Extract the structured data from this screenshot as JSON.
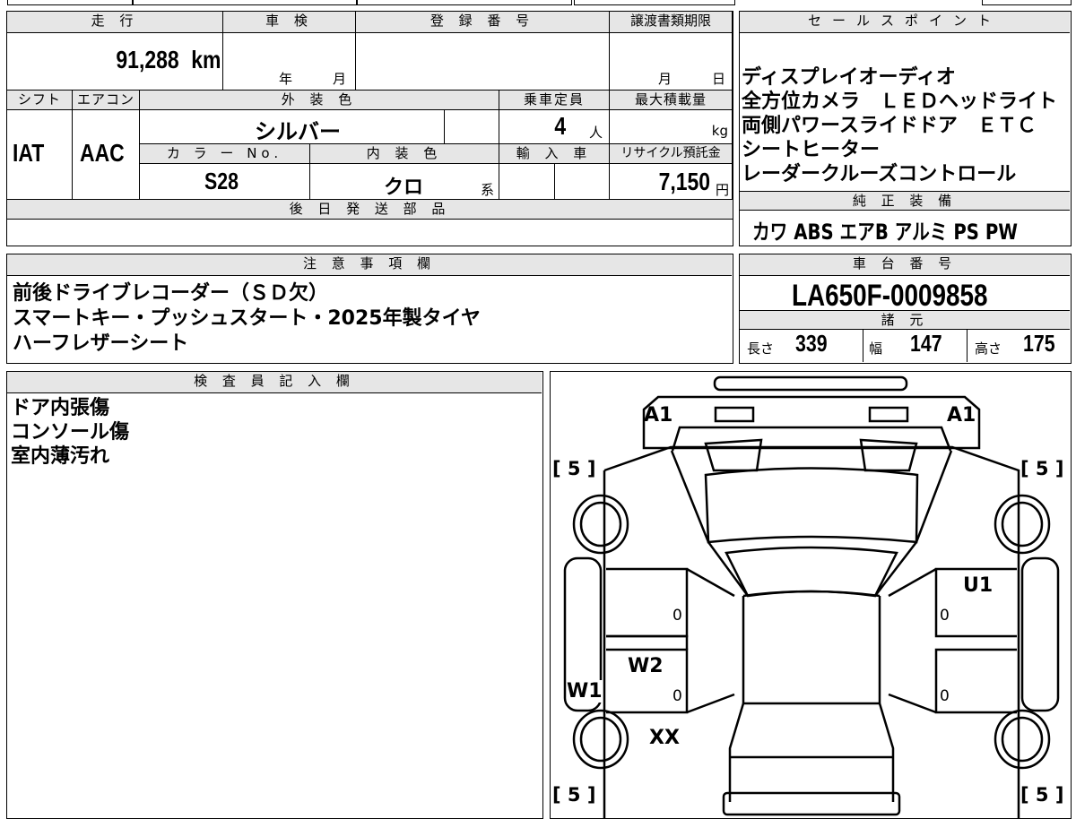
{
  "vehicle": {
    "mileage_label": "走 行",
    "mileage_value": "91,288",
    "mileage_unit": "km",
    "shaken_label": "車 検",
    "shaken_year": "年",
    "shaken_month": "月",
    "reg_label": "登 録 番 号",
    "transfer_label": "譲渡書類期限",
    "transfer_month": "月",
    "transfer_day": "日",
    "shift_label": "シフト",
    "shift_value": "IAT",
    "ac_label": "エアコン",
    "ac_value": "AAC",
    "exterior_label": "外 装 色",
    "exterior_value": "シルバー",
    "capacity_label": "乗車定員",
    "capacity_value": "4",
    "capacity_unit": "人",
    "load_label": "最大積載量",
    "load_unit": "kg",
    "colorno_label": "カ ラ ー No.",
    "colorno_value": "S28",
    "interior_label": "内 装 色",
    "interior_value": "クロ",
    "interior_suffix": "系",
    "import_label": "輸 入 車",
    "recycle_label": "リサイクル預託金",
    "recycle_value": "7,150",
    "recycle_unit": "円",
    "later_label": "後 日 発 送 部 品"
  },
  "sales": {
    "label": "セールスポイント",
    "lines": [
      "ディスプレイオーディオ",
      "全方位カメラ　ＬＥＤヘッドライト",
      "両側パワースライドドア　ＥＴＣ",
      "シートヒーター",
      "レーダークルーズコントロール"
    ]
  },
  "equipment": {
    "label": "純 正 装 備",
    "items": "カワ ABS エアB アルミ PS PW"
  },
  "notes": {
    "label": "注 意 事 項 欄",
    "lines": [
      "前後ドライブレコーダー（ＳＤ欠）",
      "スマートキー・プッシュスタート・2025年製タイヤ",
      "ハーフレザーシート"
    ]
  },
  "chassis": {
    "label": "車 台 番 号",
    "value": "LA650F-0009858",
    "spec_label": "諸 元",
    "length_label": "長さ",
    "length_value": "339",
    "width_label": "幅",
    "width_value": "147",
    "height_label": "高さ",
    "height_value": "175"
  },
  "inspector": {
    "label": "検 査 員 記 入 欄",
    "lines": [
      "ドア内張傷",
      "コンソール傷",
      "室内薄汚れ"
    ]
  },
  "diagram": {
    "marks": {
      "a1_left": "A1",
      "a1_right": "A1",
      "u1": "U1",
      "w2": "W2",
      "w1": "W1",
      "xx": "XX"
    },
    "tires": {
      "front_left": "[ 5 ]",
      "front_right": "[ 5 ]",
      "rear_left": "[ 5 ]",
      "rear_right": "[ 5 ]"
    },
    "zeros": [
      "0",
      "0",
      "0",
      "0"
    ]
  }
}
